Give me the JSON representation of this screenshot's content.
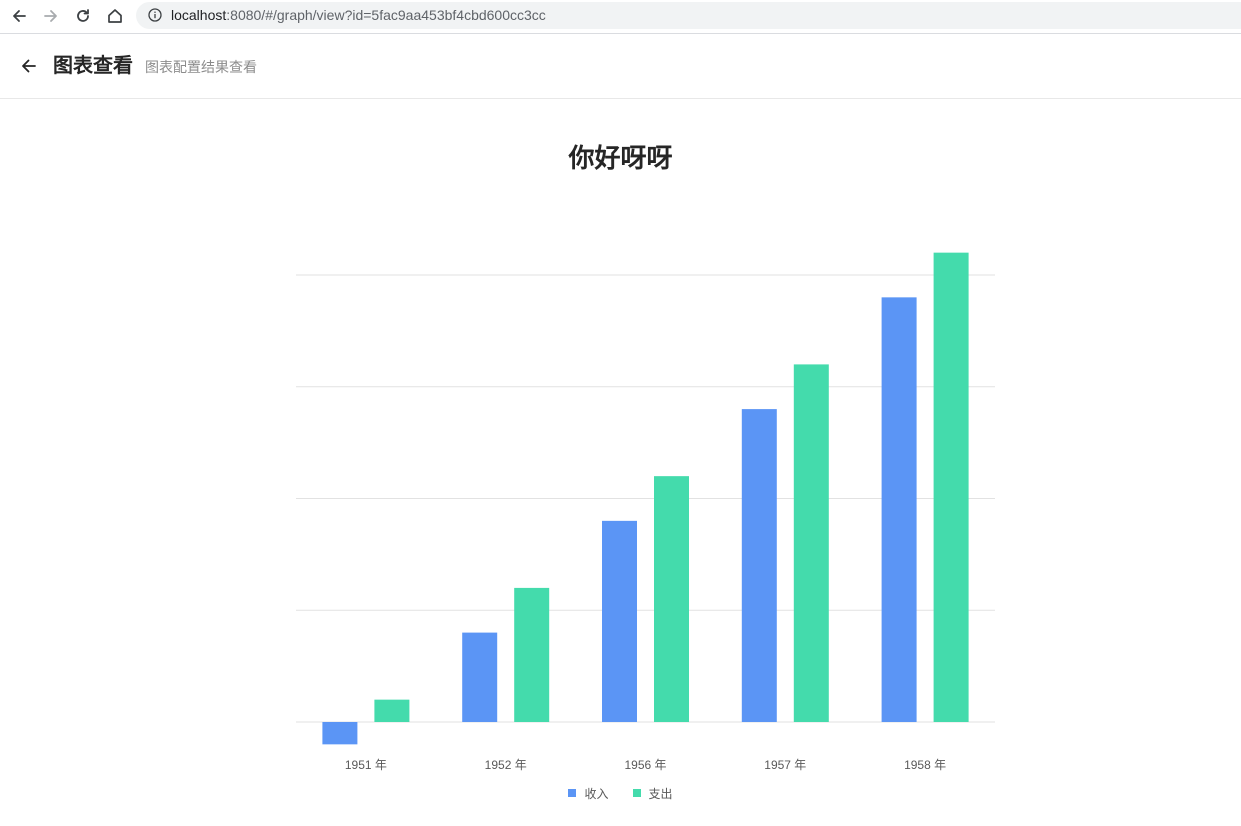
{
  "browser": {
    "url_host": "localhost",
    "url_rest": ":8080/#/graph/view?id=5fac9aa453bf4cbd600cc3cc"
  },
  "header": {
    "title": "图表查看",
    "subtitle": "图表配置结果查看"
  },
  "colors": {
    "series_income": "#5b95f5",
    "series_expense": "#44dbac",
    "grid": "#e2e2e2",
    "axis_text": "#595959"
  },
  "chart_data": {
    "type": "bar",
    "title": "你好呀呀",
    "categories": [
      "1951 年",
      "1952 年",
      "1956 年",
      "1957 年",
      "1958 年"
    ],
    "series": [
      {
        "name": "收入",
        "values": [
          -1,
          4,
          9,
          14,
          19
        ]
      },
      {
        "name": "支出",
        "values": [
          1,
          6,
          11,
          16,
          21
        ]
      }
    ],
    "ylim": [
      -1,
      21
    ],
    "grid": true,
    "y_axis_labels_visible": false,
    "legend_position": "bottom"
  }
}
